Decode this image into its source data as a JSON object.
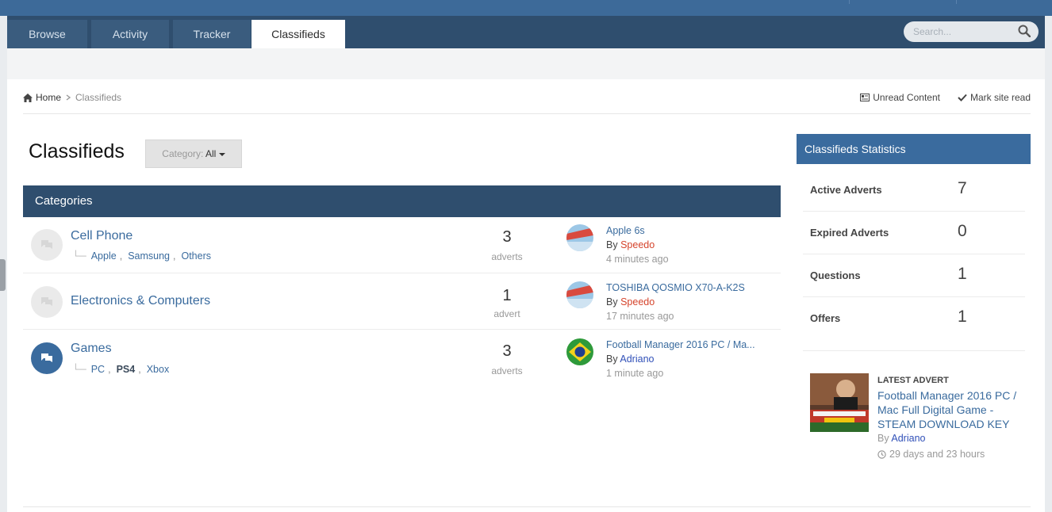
{
  "nav": {
    "tabs": [
      "Browse",
      "Activity",
      "Tracker",
      "Classifieds"
    ],
    "active_tab": "Classifieds",
    "search_placeholder": "Search..."
  },
  "breadcrumb": {
    "home": "Home",
    "current": "Classifieds",
    "actions": [
      "Unread Content",
      "Mark site read"
    ]
  },
  "page": {
    "title": "Classifieds",
    "category_label": "Category:",
    "category_value": "All"
  },
  "categories": {
    "header": "Categories",
    "rows": [
      {
        "name": "Cell Phone",
        "subs": [
          "Apple",
          "Samsung",
          "Others"
        ],
        "count": "3",
        "unit": "adverts",
        "latest_title": "Apple 6s",
        "by": "By",
        "latest_user": "Speedo",
        "latest_time": "4 minutes ago"
      },
      {
        "name": "Electronics & Computers",
        "subs": [],
        "count": "1",
        "unit": "advert",
        "latest_title": "TOSHIBA QOSMIO X70-A-K2S",
        "by": "By",
        "latest_user": "Speedo",
        "latest_time": "17 minutes ago"
      },
      {
        "name": "Games",
        "subs": [
          "PC",
          "PS4",
          "Xbox"
        ],
        "count": "3",
        "unit": "adverts",
        "latest_title": "Football Manager 2016 PC / Ma...",
        "by": "By",
        "latest_user": "Adriano",
        "latest_time": "1 minute ago"
      }
    ]
  },
  "stats": {
    "header": "Classifieds Statistics",
    "items": [
      {
        "label": "Active Adverts",
        "value": "7"
      },
      {
        "label": "Expired Adverts",
        "value": "0"
      },
      {
        "label": "Questions",
        "value": "1"
      },
      {
        "label": "Offers",
        "value": "1"
      }
    ]
  },
  "latest_advert": {
    "tag": "LATEST ADVERT",
    "title": "Football Manager 2016 PC / Mac Full Digital Game - STEAM DOWNLOAD KEY",
    "by": "By",
    "user": "Adriano",
    "time": "29 days and 23 hours"
  },
  "colors": {
    "nav_bg": "#2f4e6e",
    "accent": "#3a6b9e",
    "user_red": "#d5442c",
    "user_blue": "#3050b8"
  }
}
